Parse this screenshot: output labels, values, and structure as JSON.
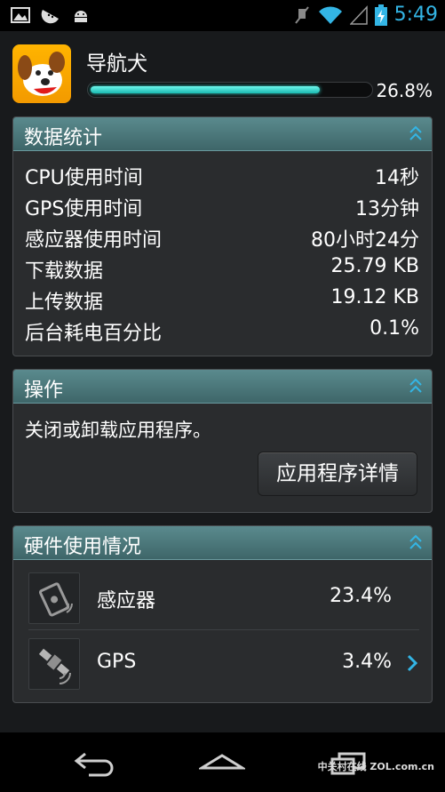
{
  "status_bar": {
    "time": "5:49",
    "left_icons": [
      "gallery-icon",
      "watermelon-icon",
      "android-icon"
    ],
    "right_icons": [
      "mute-icon",
      "wifi-icon",
      "signal-icon",
      "battery-charging-icon"
    ],
    "accent": "#33b5e5"
  },
  "app": {
    "name": "导航犬",
    "battery_percent_label": "26.8%",
    "battery_fraction": 0.268
  },
  "stats": {
    "title": "数据统计",
    "rows": [
      {
        "label": "CPU使用时间",
        "value": "14秒"
      },
      {
        "label": "GPS使用时间",
        "value": "13分钟"
      },
      {
        "label": "感应器使用时间",
        "value": "80小时24分"
      },
      {
        "label": "下载数据",
        "value": "25.79 KB"
      },
      {
        "label": "上传数据",
        "value": "19.12 KB"
      },
      {
        "label": "后台耗电百分比",
        "value": "0.1%"
      }
    ]
  },
  "operations": {
    "title": "操作",
    "description": "关闭或卸载应用程序。",
    "button_label": "应用程序详情"
  },
  "hardware": {
    "title": "硬件使用情况",
    "items": [
      {
        "name": "感应器",
        "percent": "23.4%",
        "icon": "sensor-icon"
      },
      {
        "name": "GPS",
        "percent": "3.4%",
        "icon": "satellite-icon"
      }
    ]
  },
  "nav": {
    "buttons": [
      "back-icon",
      "home-icon",
      "recent-apps-icon"
    ],
    "watermark": "中关村在线 ZOL.com.cn"
  },
  "colors": {
    "panel_header": "#4c7a7e",
    "progress": "#2fd3c8",
    "chevron": "#33b5e5"
  }
}
